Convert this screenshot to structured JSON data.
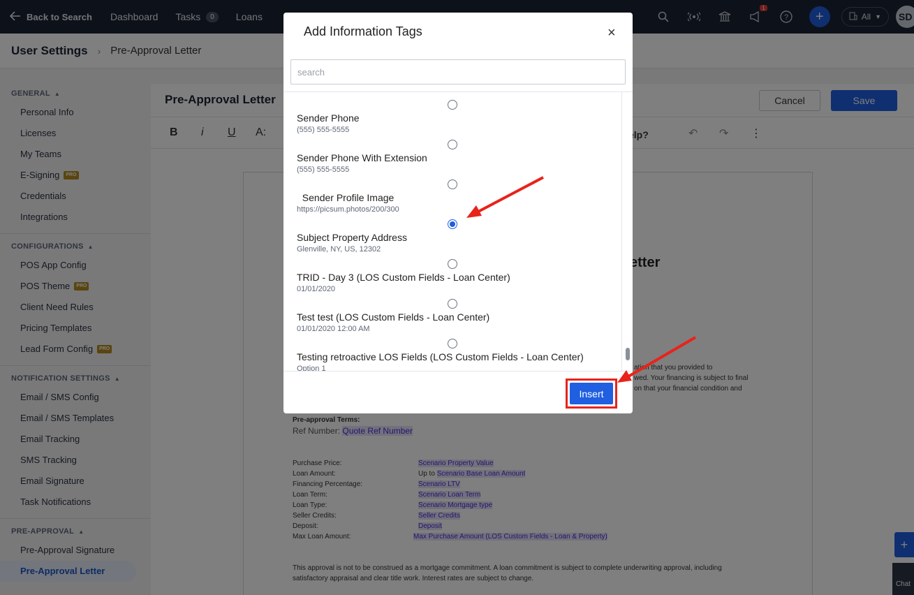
{
  "topbar": {
    "back_label": "Back to Search",
    "nav": [
      {
        "label": "Dashboard"
      },
      {
        "label": "Tasks",
        "badge": "0"
      },
      {
        "label": "Loans"
      }
    ],
    "notification_count": "1",
    "org_filter": "All",
    "avatar_initials": "SD",
    "icons": [
      "search-icon",
      "broadcast-icon",
      "bank-icon",
      "megaphone-icon",
      "help-icon",
      "plus-icon",
      "building-icon",
      "chevron-down-icon"
    ]
  },
  "subheader": {
    "title": "User Settings",
    "breadcrumb_separator": "›",
    "current": "Pre-Approval Letter"
  },
  "sidebar": {
    "sections": [
      {
        "title": "GENERAL",
        "items": [
          {
            "label": "Personal Info"
          },
          {
            "label": "Licenses"
          },
          {
            "label": "My Teams"
          },
          {
            "label": "E-Signing",
            "pro": "PRO"
          },
          {
            "label": "Credentials"
          },
          {
            "label": "Integrations"
          }
        ]
      },
      {
        "title": "CONFIGURATIONS",
        "items": [
          {
            "label": "POS App Config"
          },
          {
            "label": "POS Theme",
            "pro": "PRO"
          },
          {
            "label": "Client Need Rules"
          },
          {
            "label": "Pricing Templates"
          },
          {
            "label": "Lead Form Config",
            "pro": "PRO"
          }
        ]
      },
      {
        "title": "NOTIFICATION SETTINGS",
        "items": [
          {
            "label": "Email / SMS Config"
          },
          {
            "label": "Email / SMS Templates"
          },
          {
            "label": "Email Tracking"
          },
          {
            "label": "SMS Tracking"
          },
          {
            "label": "Email Signature"
          },
          {
            "label": "Task Notifications"
          }
        ]
      },
      {
        "title": "PRE-APPROVAL",
        "items": [
          {
            "label": "Pre-Approval Signature"
          },
          {
            "label": "Pre-Approval Letter",
            "active": true
          }
        ]
      }
    ]
  },
  "editor": {
    "title": "Pre-Approval Letter",
    "cancel_label": "Cancel",
    "save_label": "Save",
    "toolbar": {
      "bold": "B",
      "italic": "i",
      "underline": "U",
      "text_size": "A:",
      "help_partial": "elp?",
      "undo": "↶",
      "redo": "↷",
      "more": "⋮"
    }
  },
  "document": {
    "heading_partial": "etter",
    "body_partial": [
      "ation that you provided to",
      "wed. Your financing is subject to final",
      "on that your financial condition and"
    ],
    "terms_title": "Pre-approval Terms:",
    "ref_label": "Ref Number:",
    "ref_tag": "Quote Ref Number",
    "terms": [
      {
        "label": "Purchase Price:",
        "prefix": "",
        "tag": "Scenario Property Value"
      },
      {
        "label": "Loan Amount:",
        "prefix": "Up to ",
        "tag": "Scenario Base Loan Amount"
      },
      {
        "label": "Financing Percentage:",
        "prefix": "",
        "tag": "Scenario LTV"
      },
      {
        "label": "Loan Term:",
        "prefix": "",
        "tag": "Scenario Loan Term"
      },
      {
        "label": "Loan Type:",
        "prefix": "",
        "tag": "Scenario Mortgage type"
      },
      {
        "label": "Seller Credits:",
        "prefix": "",
        "tag": "Seller Credits"
      },
      {
        "label": "Deposit:",
        "prefix": "",
        "tag": "Deposit"
      },
      {
        "label": "Max Loan Amount:",
        "prefix": "",
        "tag": "Max Purchase Amount (LOS Custom Fields - Loan & Property)"
      }
    ],
    "disclaimer_1": "This approval is not to be construed as a mortgage commitment. A loan commitment is subject to  complete underwriting approval, including",
    "disclaimer_2": "satisfactory appraisal and clear title work. Interest rates are subject  to change."
  },
  "modal": {
    "title": "Add Information Tags",
    "close": "×",
    "search_placeholder": "search",
    "options": [
      {
        "label": "Sender Phone",
        "value": "(555) 555-5555",
        "selected": false
      },
      {
        "label": "Sender Phone With Extension",
        "value": "(555) 555-5555",
        "selected": false
      },
      {
        "label": "  Sender Profile Image",
        "value": "https://picsum.photos/200/300",
        "selected": false
      },
      {
        "label": "Subject Property Address",
        "value": "Glenville, NY, US, 12302",
        "selected": true
      },
      {
        "label": "TRID - Day 3 (LOS Custom Fields - Loan Center)",
        "value": "01/01/2020",
        "selected": false
      },
      {
        "label": "Test test (LOS Custom Fields - Loan Center)",
        "value": "01/01/2020 12:00 AM",
        "selected": false
      },
      {
        "label": "Testing retroactive LOS Fields (LOS Custom Fields - Loan Center)",
        "value": "Option 1",
        "selected": false
      }
    ],
    "insert_label": "Insert"
  },
  "widgets": {
    "fab": "+",
    "chat_label": "Chat"
  },
  "colors": {
    "accent": "#1f5fe0",
    "topbar": "#1b2332",
    "annotation": "#e8231a"
  }
}
